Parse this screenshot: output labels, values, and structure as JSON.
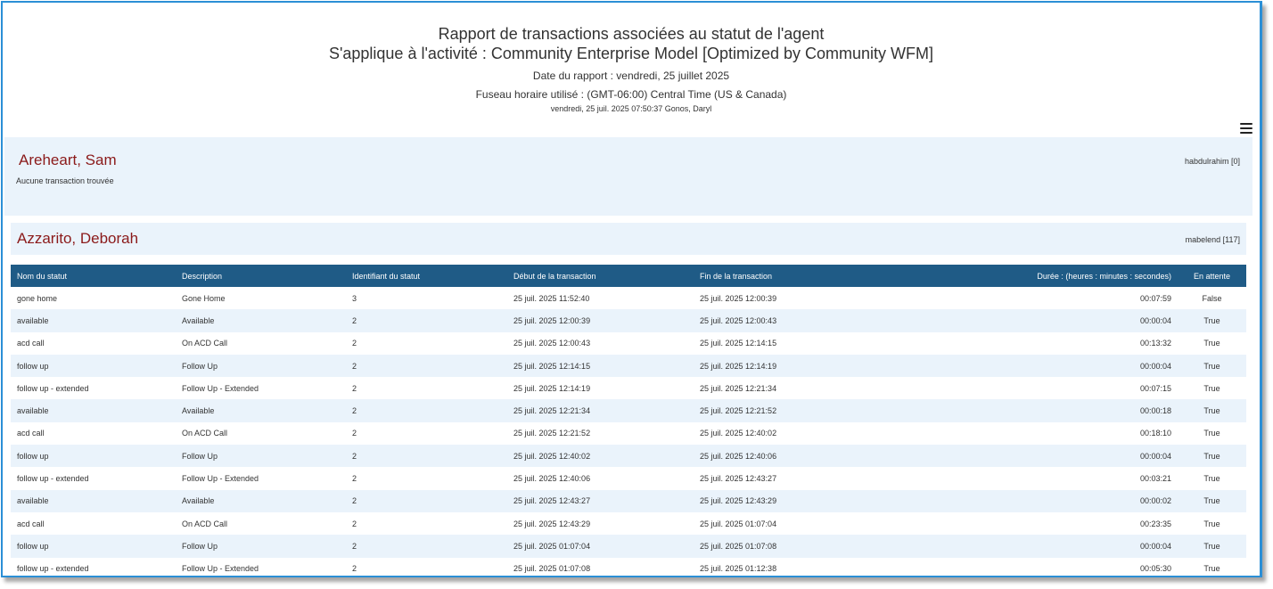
{
  "report": {
    "title": "Rapport de transactions associées au statut de l'agent",
    "subtitle": "S'applique à l'activité : Community Enterprise Model [Optimized by Community WFM]",
    "date": "Date du rapport : vendredi, 25 juillet 2025",
    "timezone": "Fuseau horaire utilisé : (GMT-06:00) Central Time (US & Canada)",
    "generated": "vendredi, 25 juil. 2025 07:50:37  Gonos, Daryl"
  },
  "menu_icon": "hamburger-menu-icon",
  "agents": [
    {
      "name": "Areheart, Sam",
      "login": "habdulrahim  [0]",
      "empty_text": "Aucune transaction trouvée"
    },
    {
      "name": "Azzarito, Deborah",
      "login": "mabelend  [117]"
    }
  ],
  "table": {
    "columns": [
      "Nom du statut",
      "Description",
      "Identifiant du statut",
      "Début de la transaction",
      "Fin de la transaction",
      "Durée : (heures : minutes : secondes)",
      "En attente"
    ],
    "rows": [
      [
        "gone home",
        "Gone Home",
        "3",
        "25 juil. 2025 11:52:40",
        "25 juil. 2025 12:00:39",
        "00:07:59",
        "False"
      ],
      [
        "available",
        "Available",
        "2",
        "25 juil. 2025 12:00:39",
        "25 juil. 2025 12:00:43",
        "00:00:04",
        "True"
      ],
      [
        "acd call",
        "On ACD Call",
        "2",
        "25 juil. 2025 12:00:43",
        "25 juil. 2025 12:14:15",
        "00:13:32",
        "True"
      ],
      [
        "follow up",
        "Follow Up",
        "2",
        "25 juil. 2025 12:14:15",
        "25 juil. 2025 12:14:19",
        "00:00:04",
        "True"
      ],
      [
        "follow up - extended",
        "Follow Up - Extended",
        "2",
        "25 juil. 2025 12:14:19",
        "25 juil. 2025 12:21:34",
        "00:07:15",
        "True"
      ],
      [
        "available",
        "Available",
        "2",
        "25 juil. 2025 12:21:34",
        "25 juil. 2025 12:21:52",
        "00:00:18",
        "True"
      ],
      [
        "acd call",
        "On ACD Call",
        "2",
        "25 juil. 2025 12:21:52",
        "25 juil. 2025 12:40:02",
        "00:18:10",
        "True"
      ],
      [
        "follow up",
        "Follow Up",
        "2",
        "25 juil. 2025 12:40:02",
        "25 juil. 2025 12:40:06",
        "00:00:04",
        "True"
      ],
      [
        "follow up - extended",
        "Follow Up - Extended",
        "2",
        "25 juil. 2025 12:40:06",
        "25 juil. 2025 12:43:27",
        "00:03:21",
        "True"
      ],
      [
        "available",
        "Available",
        "2",
        "25 juil. 2025 12:43:27",
        "25 juil. 2025 12:43:29",
        "00:00:02",
        "True"
      ],
      [
        "acd call",
        "On ACD Call",
        "2",
        "25 juil. 2025 12:43:29",
        "25 juil. 2025 01:07:04",
        "00:23:35",
        "True"
      ],
      [
        "follow up",
        "Follow Up",
        "2",
        "25 juil. 2025 01:07:04",
        "25 juil. 2025 01:07:08",
        "00:00:04",
        "True"
      ],
      [
        "follow up - extended",
        "Follow Up - Extended",
        "2",
        "25 juil. 2025 01:07:08",
        "25 juil. 2025 01:12:38",
        "00:05:30",
        "True"
      ]
    ]
  }
}
